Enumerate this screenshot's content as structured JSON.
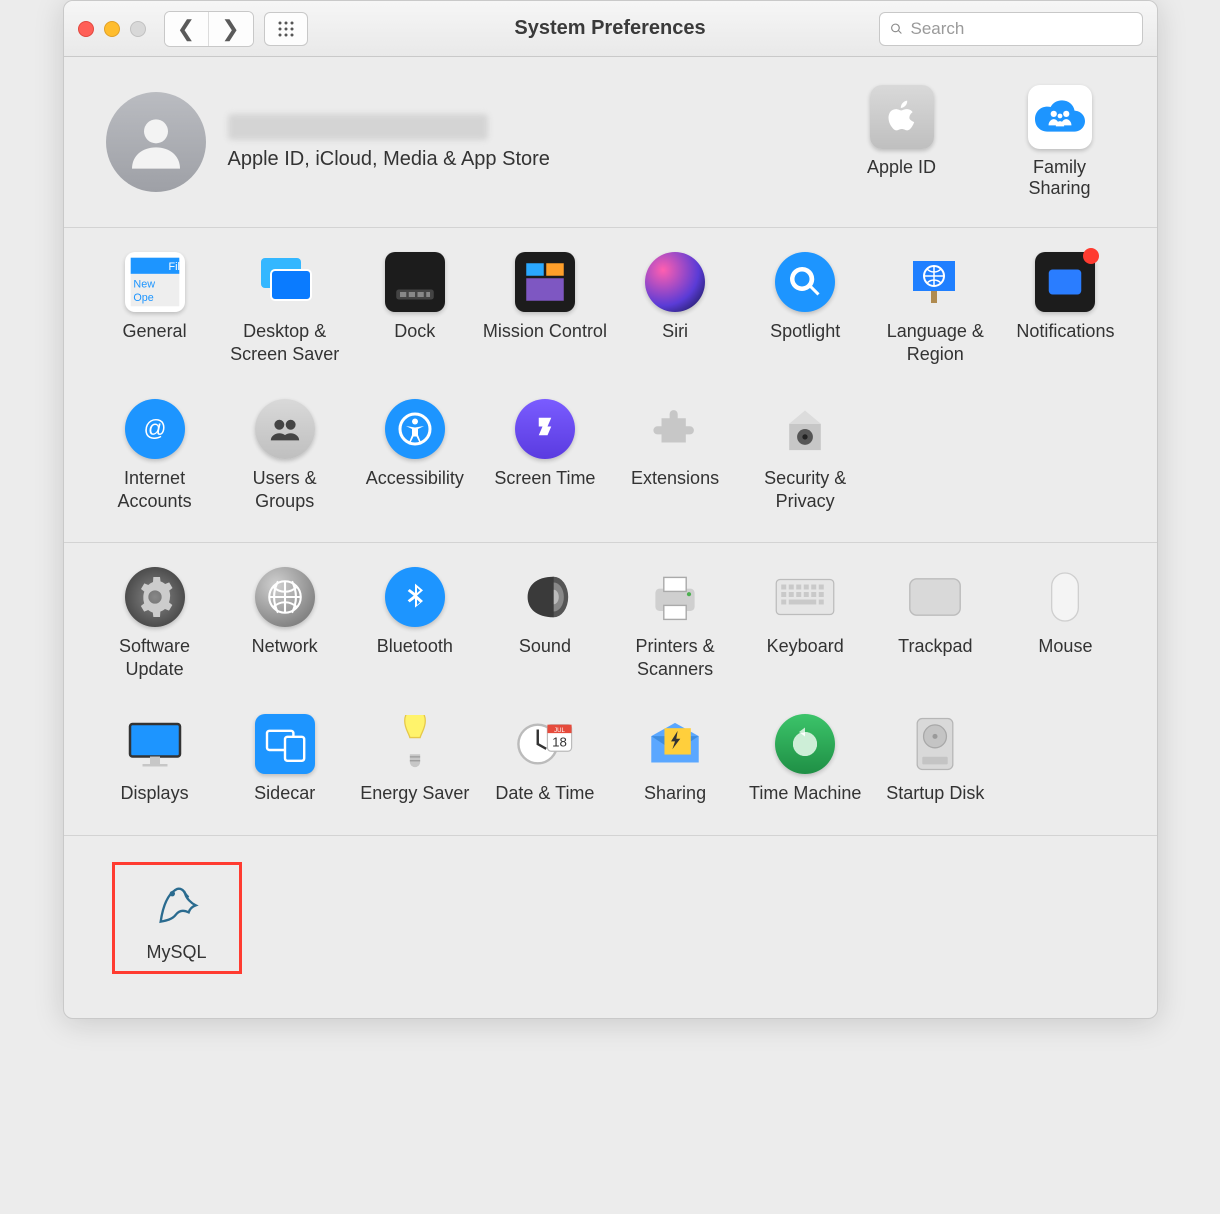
{
  "window": {
    "title": "System Preferences"
  },
  "search": {
    "placeholder": "Search"
  },
  "user": {
    "subtitle": "Apple ID, iCloud, Media & App Store"
  },
  "topRight": {
    "appleid": "Apple ID",
    "family": "Family Sharing"
  },
  "row1": {
    "general": "General",
    "desktop": "Desktop & Screen Saver",
    "dock": "Dock",
    "mission": "Mission Control",
    "siri": "Siri",
    "spotlight": "Spotlight",
    "language": "Language & Region",
    "notifications": "Notifications"
  },
  "row2": {
    "internet": "Internet Accounts",
    "users": "Users & Groups",
    "accessibility": "Accessibility",
    "screentime": "Screen Time",
    "extensions": "Extensions",
    "security": "Security & Privacy"
  },
  "row3": {
    "software": "Software Update",
    "network": "Network",
    "bluetooth": "Bluetooth",
    "sound": "Sound",
    "printers": "Printers & Scanners",
    "keyboard": "Keyboard",
    "trackpad": "Trackpad",
    "mouse": "Mouse"
  },
  "row4": {
    "displays": "Displays",
    "sidecar": "Sidecar",
    "energy": "Energy Saver",
    "datetime": "Date & Time",
    "sharing": "Sharing",
    "timemachine": "Time Machine",
    "startup": "Startup Disk"
  },
  "row5": {
    "mysql": "MySQL"
  }
}
